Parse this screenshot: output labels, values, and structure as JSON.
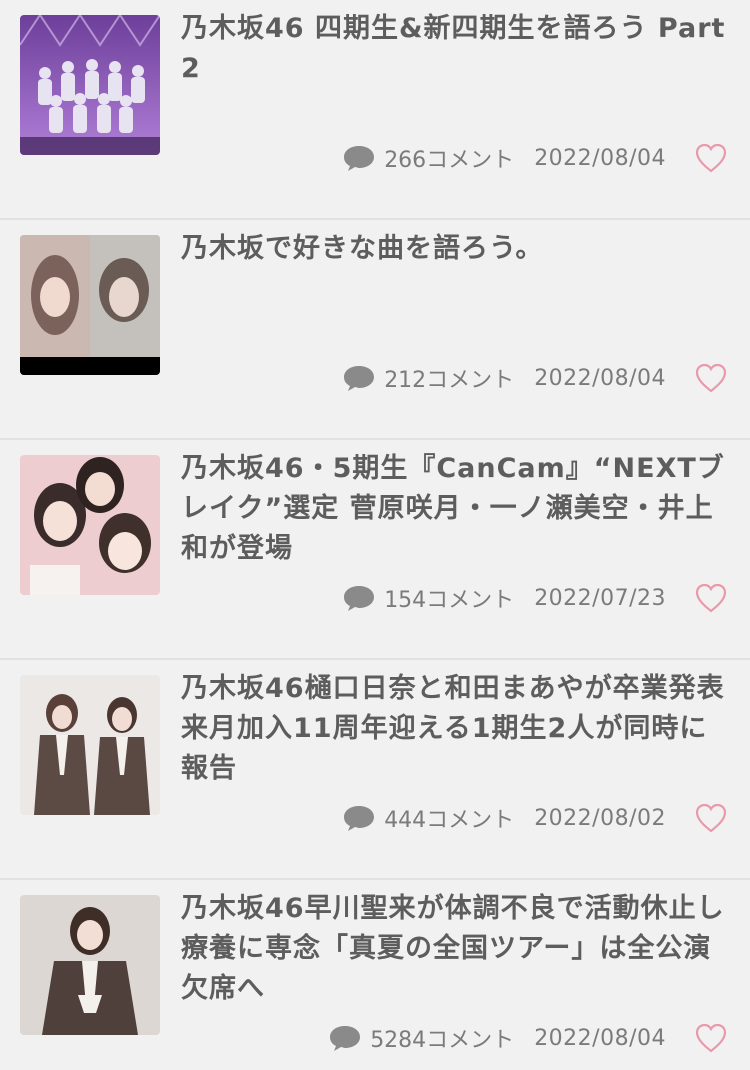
{
  "articles": [
    {
      "title": "乃木坂46 四期生&新四期生を語ろう Part2",
      "comments": "266コメント",
      "date": "2022/08/04",
      "thumb": "group-stage-photo",
      "colors": {
        "bg": "#8a5bb0",
        "accent": "#c9b3e6"
      }
    },
    {
      "title": "乃木坂で好きな曲を語ろう。",
      "comments": "212コメント",
      "date": "2022/08/04",
      "thumb": "two-portraits-photo",
      "colors": {
        "bg": "#c8b8b2",
        "accent": "#6b5a52"
      }
    },
    {
      "title": "乃木坂46・5期生『CanCam』“NEXTブレイク”選定 菅原咲月・一ノ瀬美空・井上和が登場",
      "comments": "154コメント",
      "date": "2022/07/23",
      "thumb": "three-members-photo",
      "colors": {
        "bg": "#e9c6ca",
        "accent": "#3a2c2a"
      }
    },
    {
      "title": "乃木坂46樋口日奈と和田まあやが卒業発表　来月加入11周年迎える1期生2人が同時に報告",
      "comments": "444コメント",
      "date": "2022/08/02",
      "thumb": "two-members-plaid-photo",
      "colors": {
        "bg": "#e2dfdc",
        "accent": "#5c4b45"
      }
    },
    {
      "title": "乃木坂46早川聖来が体調不良で活動休止し療養に専念「真夏の全国ツアー」は全公演欠席へ",
      "comments": "5284コメント",
      "date": "2022/08/04",
      "thumb": "single-member-photo",
      "colors": {
        "bg": "#d8d3ce",
        "accent": "#4f403b"
      }
    }
  ],
  "ui": {
    "text_color": "#5d5d5d",
    "meta_color": "#7b7b7b",
    "heart_color": "#e89aaa",
    "icon_color": "#8a8a8a"
  }
}
